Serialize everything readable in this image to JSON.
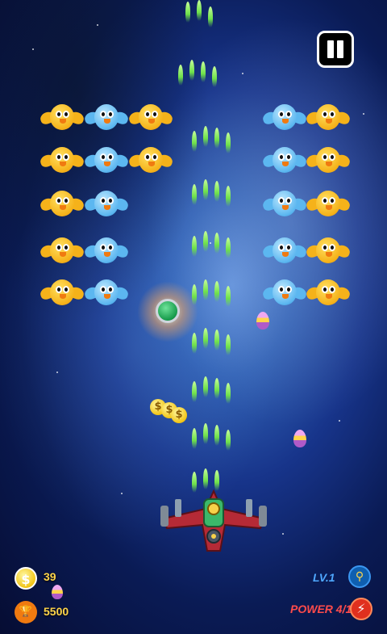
{
  "hud": {
    "coins": "39",
    "score": "5500",
    "level_label": "LV.1",
    "power_label": "POWER 4/12"
  },
  "icons": {
    "pause": "pause-icon",
    "coin": "dollar-coin-icon",
    "trophy": "trophy-icon",
    "map": "map-pin-icon",
    "power": "lightning-bolt-icon"
  },
  "colors": {
    "bullet": "#6de04a",
    "yellow_chick": "#f5b21a",
    "blue_chick": "#5cb7f0",
    "power_text": "#ff4b4b",
    "level_text": "#4fa8ff"
  },
  "enemies": {
    "left_grid": [
      [
        "yellow",
        "blue",
        "yellow"
      ],
      [
        "yellow",
        "blue",
        "yellow"
      ],
      [
        "yellow",
        "blue"
      ],
      [
        "yellow",
        "blue"
      ],
      [
        "yellow",
        "blue"
      ]
    ],
    "right_grid": [
      [
        "blue",
        "yellow"
      ],
      [
        "blue",
        "yellow"
      ],
      [
        "blue",
        "yellow"
      ],
      [
        "blue",
        "yellow"
      ],
      [
        "blue",
        "yellow"
      ]
    ]
  },
  "coin_glyph": "$"
}
